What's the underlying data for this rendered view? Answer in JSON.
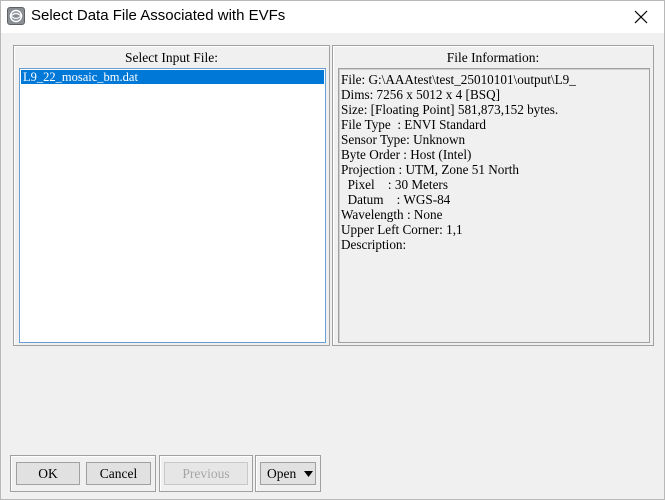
{
  "window": {
    "title": "Select Data File Associated with EVFs"
  },
  "icons": {
    "app": "envi-app-icon",
    "close": "close-icon",
    "dropdown": "triangle-down-icon"
  },
  "left_panel": {
    "label": "Select Input File:",
    "files": [
      "L9_22_mosaic_bm.dat"
    ],
    "selected_index": 0
  },
  "right_panel": {
    "label": "File Information:",
    "lines": [
      "File: G:\\AAAtest\\test_25010101\\output\\L9_",
      "Dims: 7256 x 5012 x 4 [BSQ]",
      "Size: [Floating Point] 581,873,152 bytes.",
      "File Type  : ENVI Standard",
      "Sensor Type: Unknown",
      "Byte Order : Host (Intel)",
      "Projection : UTM, Zone 51 North",
      "  Pixel    : 30 Meters",
      "  Datum    : WGS-84",
      "Wavelength : None",
      "Upper Left Corner: 1,1",
      "Description:"
    ]
  },
  "buttons": {
    "ok": "OK",
    "cancel": "Cancel",
    "previous": "Previous",
    "open": "Open"
  },
  "colors": {
    "selection": "#0078d7",
    "disabled_text": "#a6a6a6"
  }
}
